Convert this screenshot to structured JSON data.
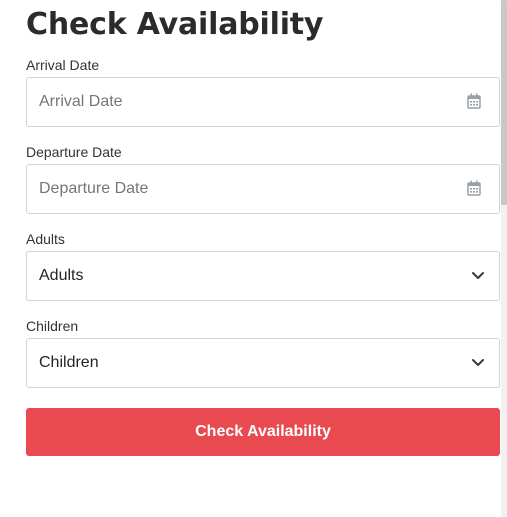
{
  "form": {
    "title": "Check Availability",
    "arrival": {
      "label": "Arrival Date",
      "placeholder": "Arrival Date"
    },
    "departure": {
      "label": "Departure Date",
      "placeholder": "Departure Date"
    },
    "adults": {
      "label": "Adults",
      "selected": "Adults"
    },
    "children": {
      "label": "Children",
      "selected": "Children"
    },
    "submit_label": "Check Availability"
  },
  "colors": {
    "button_bg": "#e84a50",
    "border": "#ced4da",
    "icon": "#9aa0a6"
  },
  "icons": {
    "date": "calendar-icon",
    "select": "chevron-down-icon"
  }
}
